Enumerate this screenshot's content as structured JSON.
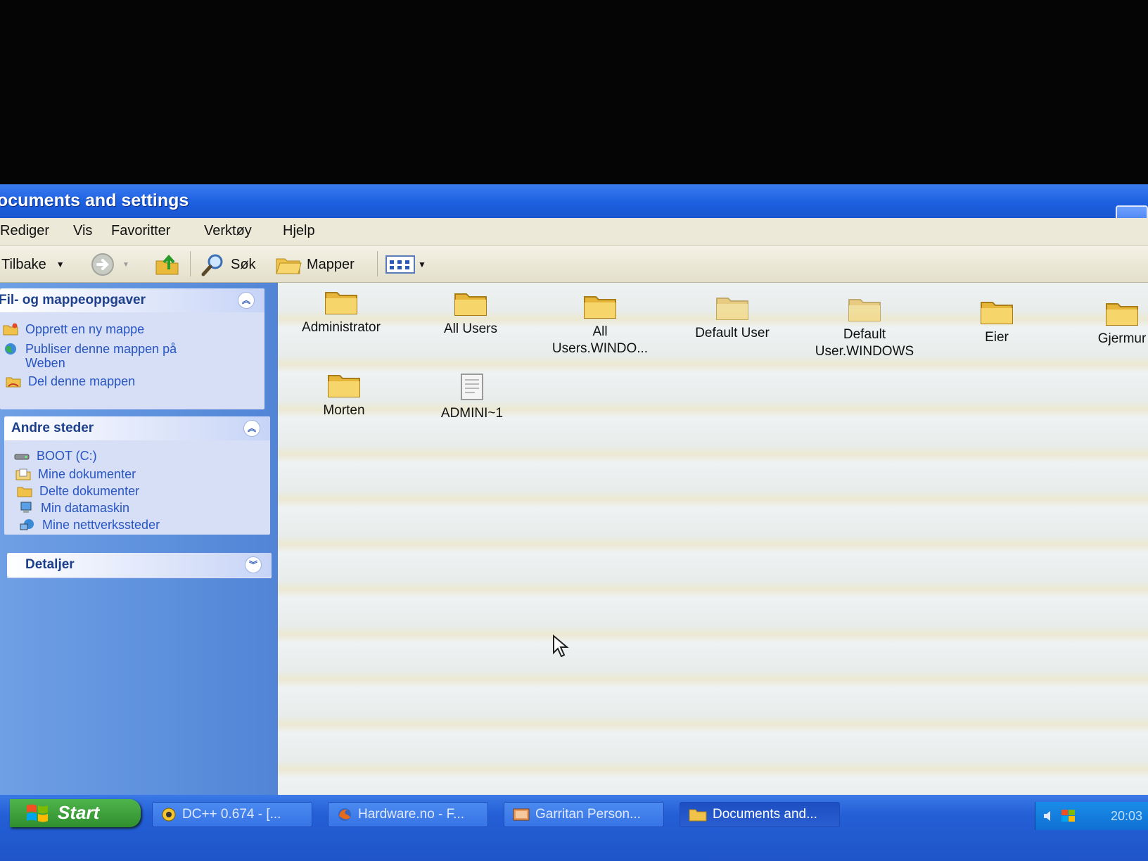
{
  "window": {
    "title": "ocuments and settings"
  },
  "menu": [
    "Rediger",
    "Vis",
    "Favoritter",
    "Verktøy",
    "Hjelp"
  ],
  "toolbar": {
    "back_label": "Tilbake",
    "search_label": "Søk",
    "folders_label": "Mapper"
  },
  "taskpane": {
    "file_tasks": {
      "title": "Fil- og mappeoppgaver",
      "items": [
        {
          "label": "Opprett en ny mappe",
          "icon": "new-folder-icon"
        },
        {
          "label": "Publiser denne mappen på",
          "label2": "Weben",
          "icon": "globe-icon"
        },
        {
          "label": "Del denne mappen",
          "icon": "share-folder-icon"
        }
      ]
    },
    "other_places": {
      "title": "Andre steder",
      "items": [
        {
          "label": "BOOT (C:)",
          "icon": "drive-icon"
        },
        {
          "label": "Mine dokumenter",
          "icon": "my-documents-icon"
        },
        {
          "label": "Delte dokumenter",
          "icon": "shared-documents-icon"
        },
        {
          "label": "Min datamaskin",
          "icon": "my-computer-icon"
        },
        {
          "label": "Mine nettverkssteder",
          "icon": "network-places-icon"
        }
      ]
    },
    "details": {
      "title": "Detaljer"
    }
  },
  "files": [
    {
      "name": "Administrator",
      "type": "folder"
    },
    {
      "name": "All Users",
      "type": "folder"
    },
    {
      "name": "All",
      "name2": "Users.WINDO...",
      "type": "folder"
    },
    {
      "name": "Default User",
      "type": "folder"
    },
    {
      "name": "Default",
      "name2": "User.WINDOWS",
      "type": "folder"
    },
    {
      "name": "Eier",
      "type": "folder"
    },
    {
      "name": "Gjermur",
      "type": "folder"
    },
    {
      "name": "Morten",
      "type": "folder"
    },
    {
      "name": "ADMINI~1",
      "type": "file"
    }
  ],
  "taskbar": {
    "start_label": "Start",
    "buttons": [
      {
        "label": "DC++ 0.674 - [...",
        "icon": "dcpp-icon"
      },
      {
        "label": "Hardware.no - F...",
        "icon": "firefox-icon"
      },
      {
        "label": "Garritan Person...",
        "icon": "app-icon"
      },
      {
        "label": "Documents and...",
        "icon": "folder-icon"
      }
    ],
    "clock": "20:03"
  },
  "colors": {
    "titlebar": "#1c5fe0",
    "taskpane": "#5b8fdc",
    "folder": "#f2c94c",
    "link": "#2855c4"
  }
}
